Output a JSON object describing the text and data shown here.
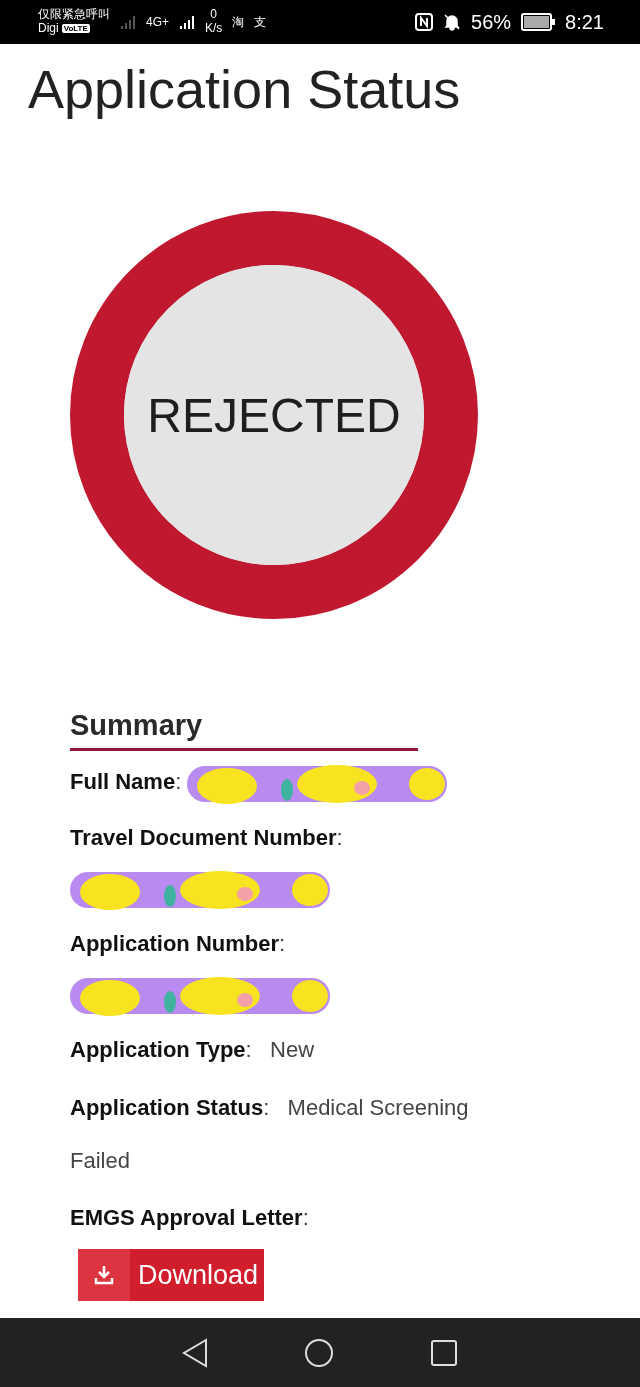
{
  "status_bar": {
    "carrier_notice": "仅限紧急呼叫",
    "carrier": "Digi",
    "volte": "VoLTE",
    "network": "4G+",
    "speed_value": "0",
    "speed_unit": "K/s",
    "app_glyphs": [
      "淘",
      "支"
    ],
    "battery": "56%",
    "time": "8:21"
  },
  "title": "Application Status",
  "status_badge": {
    "text": "REJECTED",
    "color": "#c0182f"
  },
  "summary": {
    "heading": "Summary",
    "fields": [
      {
        "text": "**Full Name**:",
        "redacted": true
      },
      {
        "text": "**Travel Document Number**:",
        "redacted": true
      },
      {
        "text": "**Application Number**:",
        "redacted": true
      },
      {
        "text": "**Application Type**:   New",
        "redacted": false
      },
      {
        "text": "**Application Status**:   Medical Screening Failed",
        "redacted": false
      },
      {
        "text": "**EMGS Approval Letter**:",
        "redacted": false
      }
    ],
    "download_button": "Download"
  }
}
